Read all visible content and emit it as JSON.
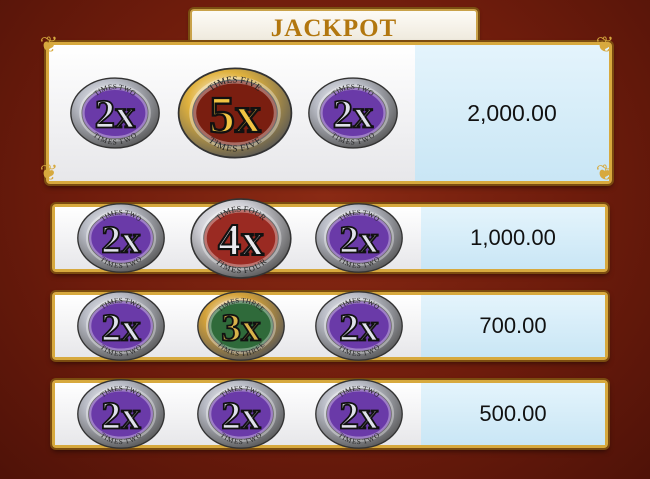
{
  "header": {
    "title": "JACKPOT"
  },
  "rows": [
    {
      "symbols": [
        "2x",
        "5x",
        "2x"
      ],
      "payout": "2,000.00"
    },
    {
      "symbols": [
        "2x",
        "4x",
        "2x"
      ],
      "payout": "1,000.00"
    },
    {
      "symbols": [
        "2x",
        "3x",
        "2x"
      ],
      "payout": "700.00"
    },
    {
      "symbols": [
        "2x",
        "2x",
        "2x"
      ],
      "payout": "500.00"
    }
  ],
  "coins": {
    "2x": {
      "label": "2x",
      "top_text": "TIMES TWO",
      "bottom_text": "TIMES TWO",
      "rim": "#b9bcc6",
      "face": "#6a3aa8",
      "digit": "#dfe1ea"
    },
    "3x": {
      "label": "3x",
      "top_text": "TIMES THREE",
      "bottom_text": "TIMES THREE",
      "rim": "#d4a23a",
      "face": "#2f6a3a",
      "digit": "#d8b24a"
    },
    "4x": {
      "label": "4x",
      "top_text": "TIMES FOUR",
      "bottom_text": "TIMES FOUR",
      "rim": "#cfcfd6",
      "face": "#9a2a22",
      "digit": "#e9e9ee"
    },
    "5x": {
      "label": "5x",
      "top_text": "TIMES FIVE",
      "bottom_text": "TIMES FIVE",
      "rim": "#e0b23e",
      "face": "#7a1e10",
      "digit": "#f2c443"
    }
  },
  "colors": {
    "frame_gold": "#d7a93e",
    "background": "#6e1c0c",
    "payout_panel": "#d6ecf8"
  }
}
